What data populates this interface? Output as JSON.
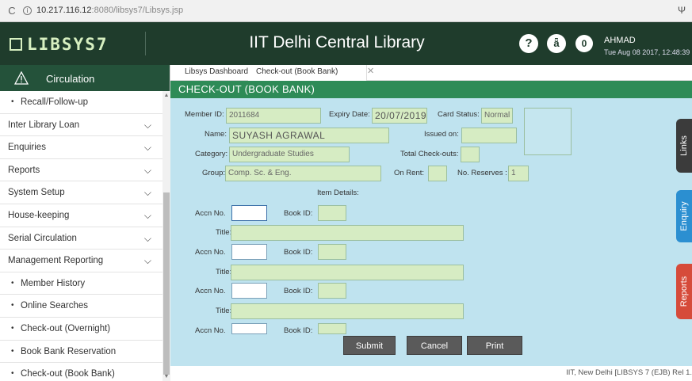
{
  "browser": {
    "reload_icon": "reload-icon",
    "url_host": "10.217.116.12",
    "url_rest": ":8080/libsys7/Libsys.jsp",
    "ext_glyph": "Ψ"
  },
  "header": {
    "logo": "LIBSYS7",
    "title": "IIT Delhi Central Library",
    "help_label": "?",
    "face_label": "ǟ",
    "notification_count": "0",
    "user_name": "AHMAD",
    "user_datetime": "Tue Aug 08 2017, 12:48:39"
  },
  "sidebar": {
    "heading": "Circulation",
    "items": [
      {
        "label": "Recall/Follow-up"
      },
      {
        "label": "Inter Library Loan"
      },
      {
        "label": "Enquiries"
      },
      {
        "label": "Reports"
      },
      {
        "label": "System Setup"
      },
      {
        "label": "House-keeping"
      },
      {
        "label": "Serial Circulation"
      },
      {
        "label": "Management Reporting"
      },
      {
        "label": "Member History"
      },
      {
        "label": "Online Searches"
      },
      {
        "label": "Check-out (Overnight)"
      },
      {
        "label": "Book Bank Reservation"
      },
      {
        "label": "Check-out (Book Bank)"
      }
    ]
  },
  "tabs": {
    "dashboard": "Libsys Dashboard",
    "active": "Check-out (Book Bank)",
    "close_glyph": "✕"
  },
  "form": {
    "title": "CHECK-OUT (BOOK BANK)",
    "member_id_label": "Member ID:",
    "member_id": "2011684",
    "expiry_label": "Expiry Date:",
    "expiry": "20/07/2019",
    "card_status_label": "Card Status:",
    "card_status": "Normal",
    "name_label": "Name:",
    "name": "SUYASH AGRAWAL",
    "issued_on_label": "Issued on:",
    "issued_on": "",
    "category_label": "Category:",
    "category": "Undergraduate Studies",
    "total_checkouts_label": "Total Check-outs:",
    "total_checkouts": "",
    "group_label": "Group:",
    "group": "Comp. Sc. & Eng.",
    "on_rent_label": "On Rent:",
    "on_rent": "",
    "reserves_label": "No. Reserves :",
    "reserves": "1",
    "item_details_label": "Item Details:",
    "accn_label": "Accn No.",
    "book_id_label": "Book ID:",
    "title_label": "Title:",
    "items": [
      {
        "accn": "",
        "book_id": "",
        "title": ""
      },
      {
        "accn": "",
        "book_id": "",
        "title": ""
      },
      {
        "accn": "",
        "book_id": "",
        "title": ""
      },
      {
        "accn": "",
        "book_id": ""
      }
    ],
    "submit": "Submit",
    "cancel": "Cancel",
    "print": "Print"
  },
  "side_tabs": {
    "links": "Links",
    "enquiry": "Enquiry",
    "reports": "Reports"
  },
  "footer": {
    "text": "IIT, New Delhi [LIBSYS 7 (EJB) Rel 1."
  }
}
